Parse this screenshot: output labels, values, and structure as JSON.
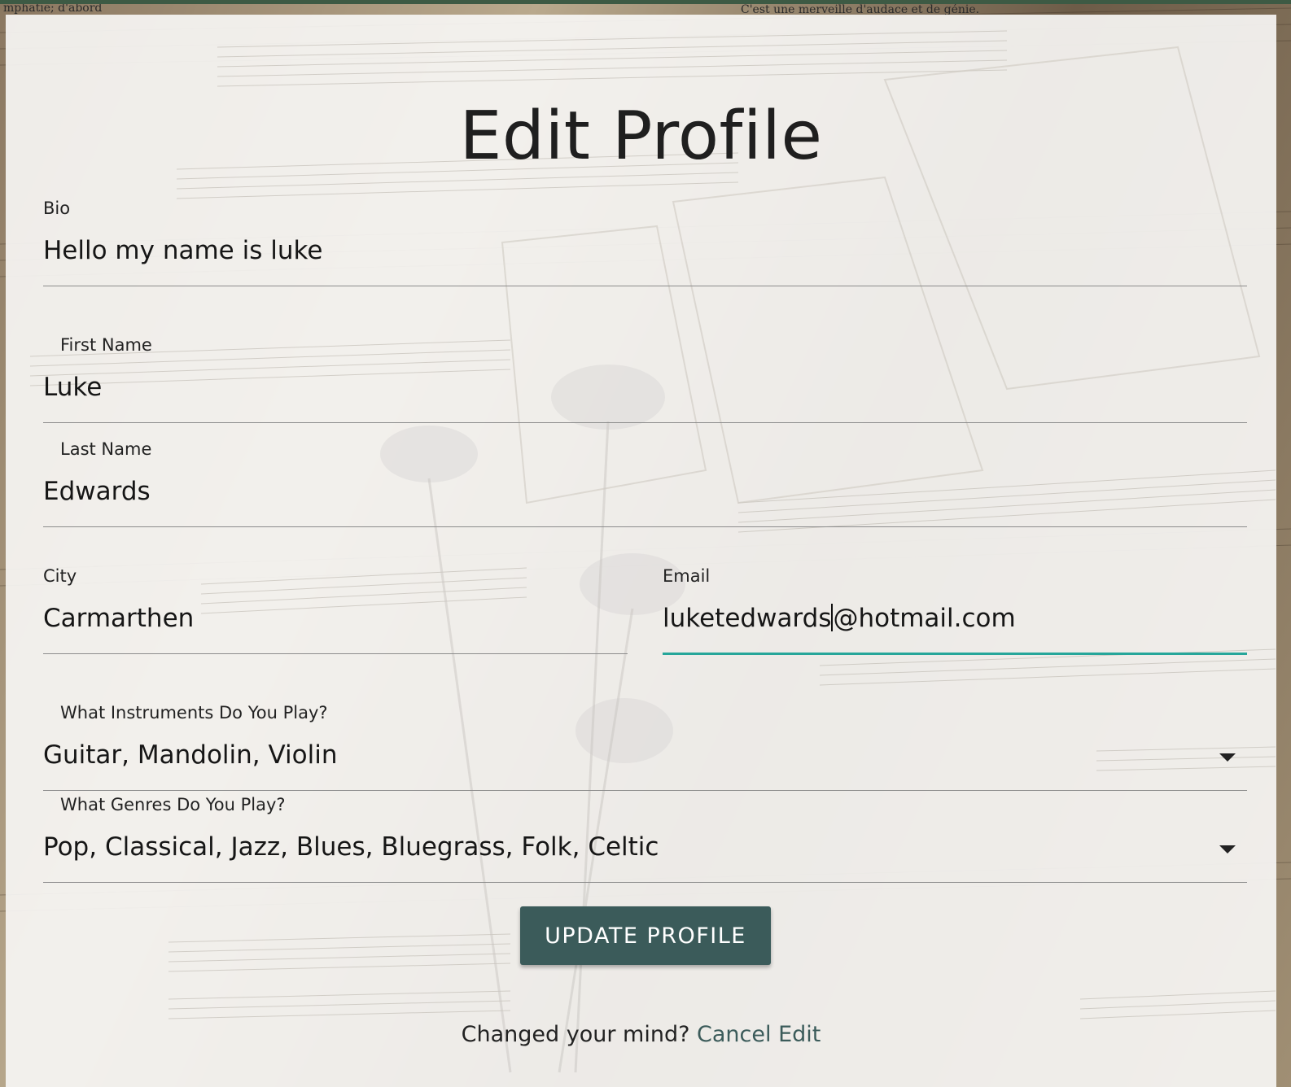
{
  "page": {
    "title": "Edit Profile"
  },
  "form": {
    "bio": {
      "label": "Bio",
      "value": "Hello my name is luke"
    },
    "first_name": {
      "label": "First Name",
      "value": "Luke"
    },
    "last_name": {
      "label": "Last Name",
      "value": "Edwards"
    },
    "city": {
      "label": "City",
      "value": "Carmarthen"
    },
    "email": {
      "label": "Email",
      "value_before_caret": "luketedwards",
      "value_after_caret": "@hotmail.com",
      "value": "luketedwards@hotmail.com"
    },
    "instruments": {
      "label": "What Instruments Do You Play?",
      "value": "Guitar, Mandolin, Violin"
    },
    "genres": {
      "label": "What Genres Do You Play?",
      "value": "Pop, Classical, Jazz, Blues, Bluegrass, Folk, Celtic"
    }
  },
  "actions": {
    "update_label": "UPDATE PROFILE",
    "cancel_prompt": "Changed your mind?",
    "cancel_link": "Cancel Edit"
  },
  "background": {
    "text_top_left": "mphatie; d'abord",
    "text_top_right": "C'est une merveille d'audace et de génie."
  },
  "colors": {
    "accent": "#26a69a",
    "button": "#3b5b5a",
    "link": "#3b5b5a"
  },
  "icons": {
    "dropdown": "caret-down-icon"
  }
}
